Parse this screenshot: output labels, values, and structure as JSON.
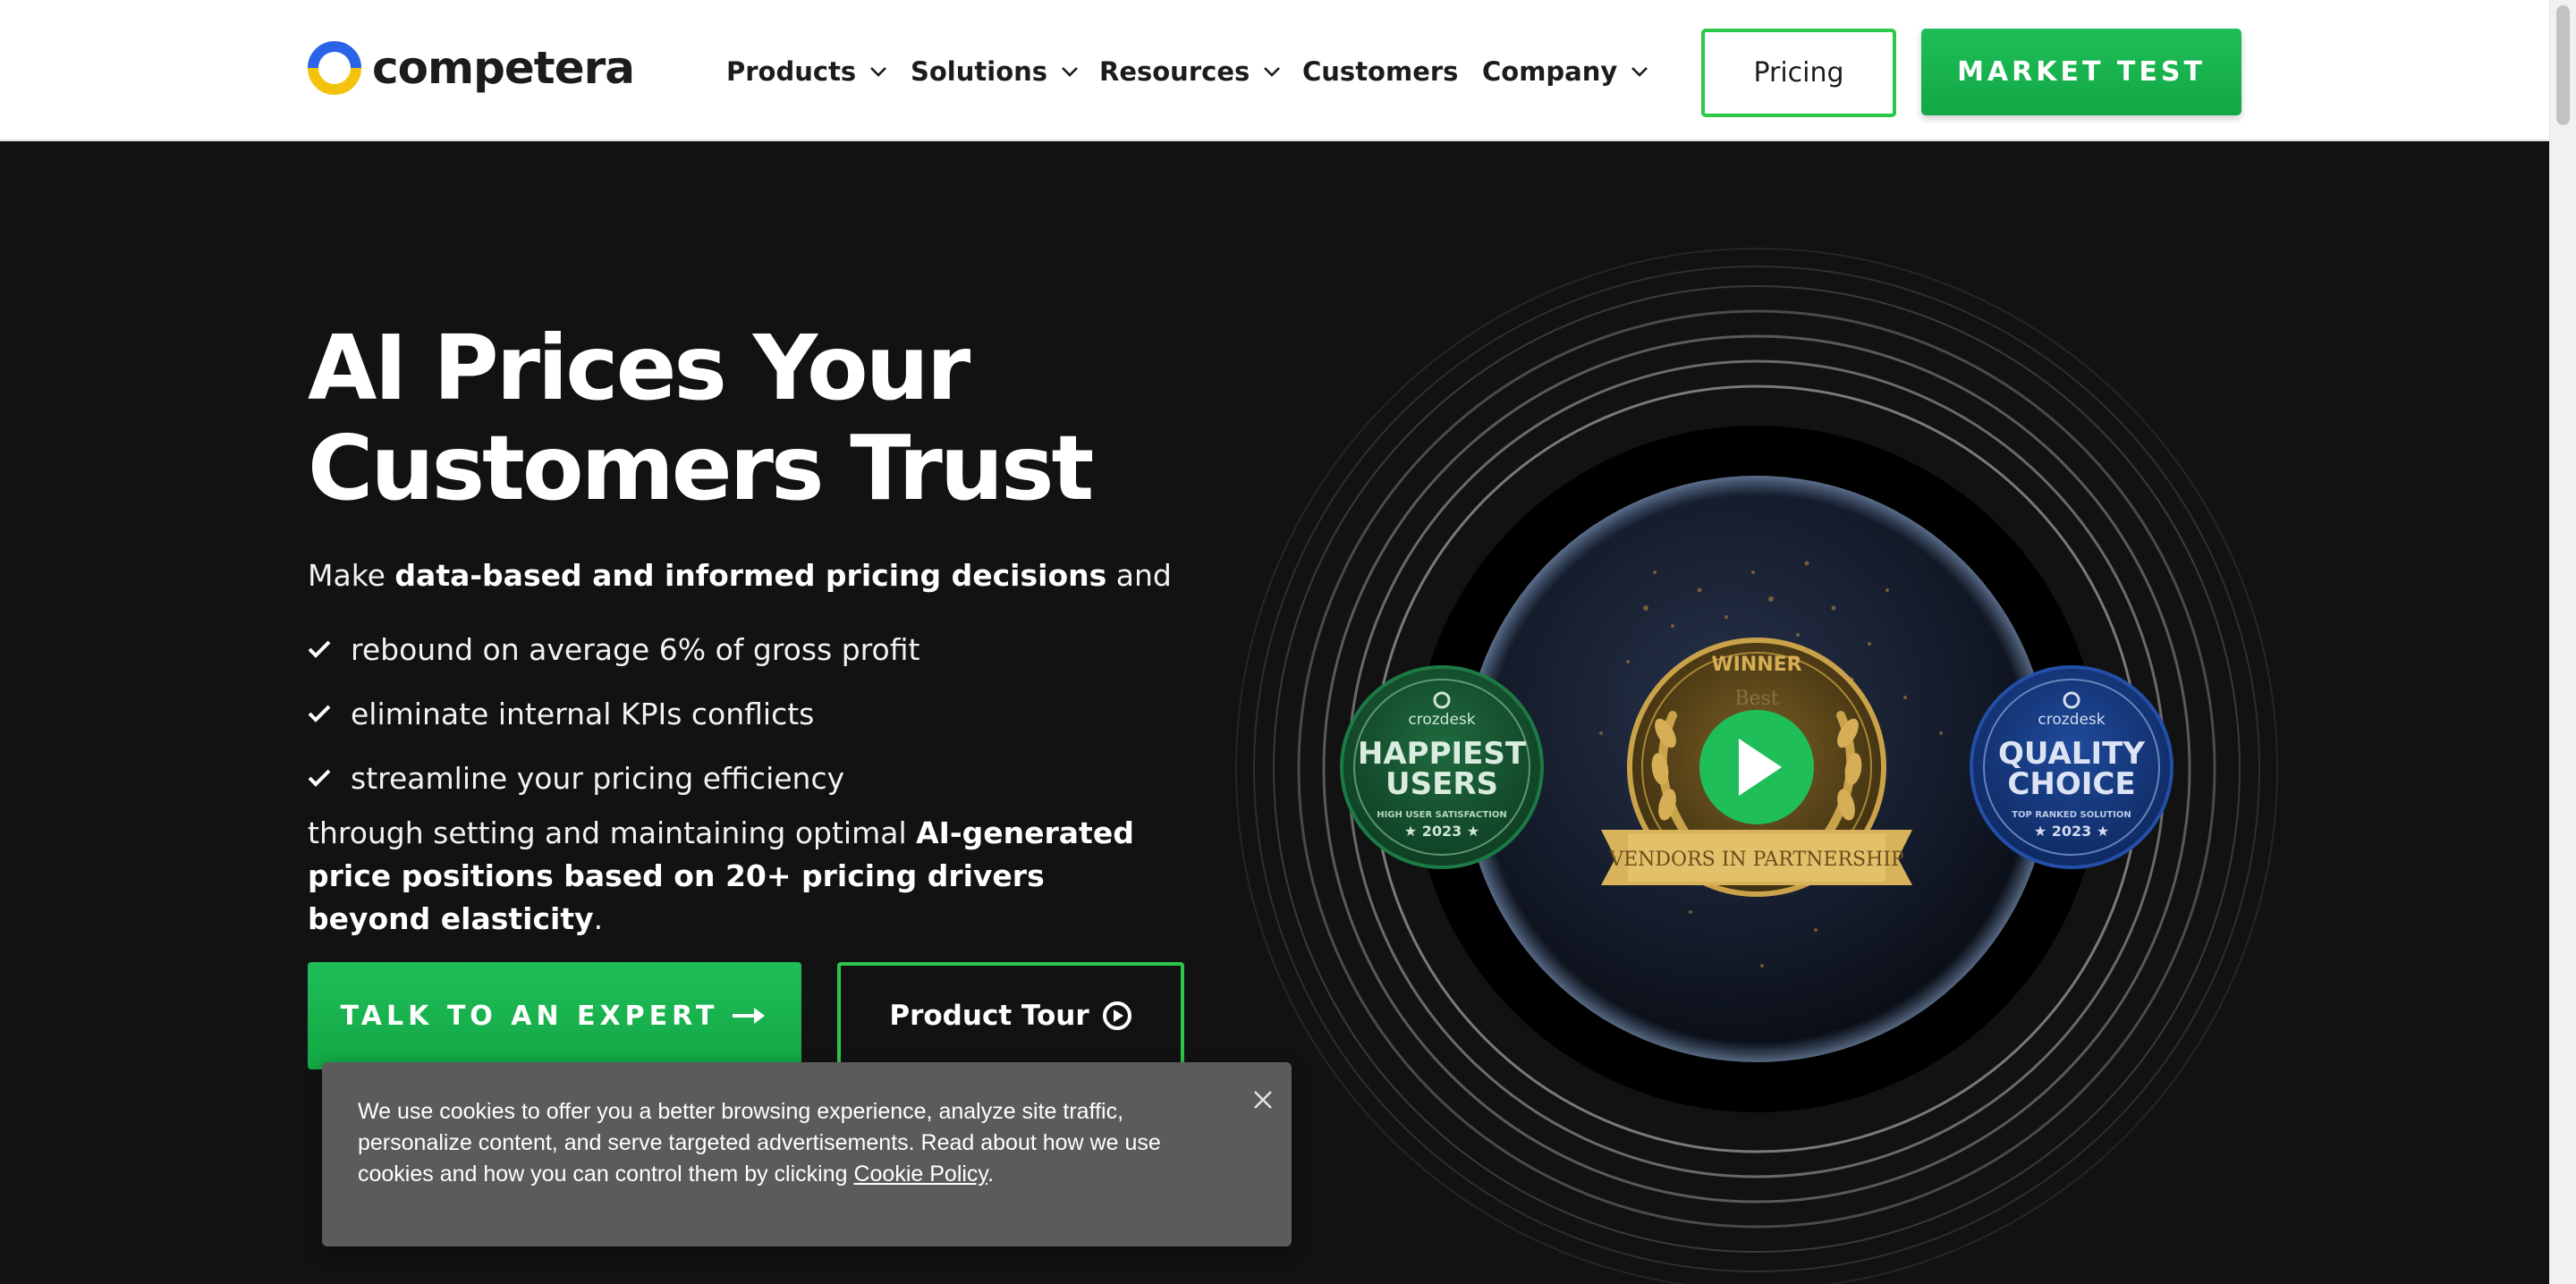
{
  "brand": {
    "name": "competera",
    "logo_colors": [
      "#2b63e8",
      "#f4c20d"
    ]
  },
  "nav": {
    "items": [
      {
        "label": "Products",
        "dropdown": true
      },
      {
        "label": "Solutions",
        "dropdown": true
      },
      {
        "label": "Resources",
        "dropdown": true
      },
      {
        "label": "Customers",
        "dropdown": false
      },
      {
        "label": "Company",
        "dropdown": true
      }
    ],
    "pricing_label": "Pricing",
    "market_test_label": "MARKET TEST"
  },
  "hero": {
    "title_line1": "AI Prices Your",
    "title_line2": "Customers Trust",
    "intro_prefix": "Make ",
    "intro_bold": "data-based and informed pricing decisions",
    "intro_suffix": " and",
    "bullets": [
      "rebound on average 6% of gross profit",
      "eliminate internal KPIs conflicts",
      "streamline your pricing efficiency"
    ],
    "outro_prefix": "through setting and maintaining optimal ",
    "outro_bold": "AI-generated price positions based on 20+ pricing drivers beyond elasticity",
    "outro_suffix": ".",
    "cta_primary": "TALK TO AN EXPERT",
    "cta_secondary": "Product Tour"
  },
  "badges": {
    "left": {
      "brand": "crozdesk",
      "line1": "HAPPIEST",
      "line2": "USERS",
      "sub": "HIGH USER SATISFACTION",
      "year": "★ 2023 ★"
    },
    "center": {
      "top": "WINNER",
      "mid": "Best",
      "ribbon": "VENDORS IN PARTNERSHIP"
    },
    "right": {
      "brand": "crozdesk",
      "line1": "QUALITY",
      "line2": "CHOICE",
      "sub": "TOP RANKED SOLUTION",
      "year": "★ 2023 ★"
    }
  },
  "cookie": {
    "text": "We use cookies to offer you a better browsing experience, analyze site traffic, personalize content, and serve targeted advertisements. Read about how we use cookies and how you can control them by clicking ",
    "link_label": "Cookie Policy",
    "suffix": "."
  },
  "colors": {
    "accent_green": "#1db954",
    "dark_bg": "#121212",
    "cookie_bg": "#5b5b5b"
  }
}
